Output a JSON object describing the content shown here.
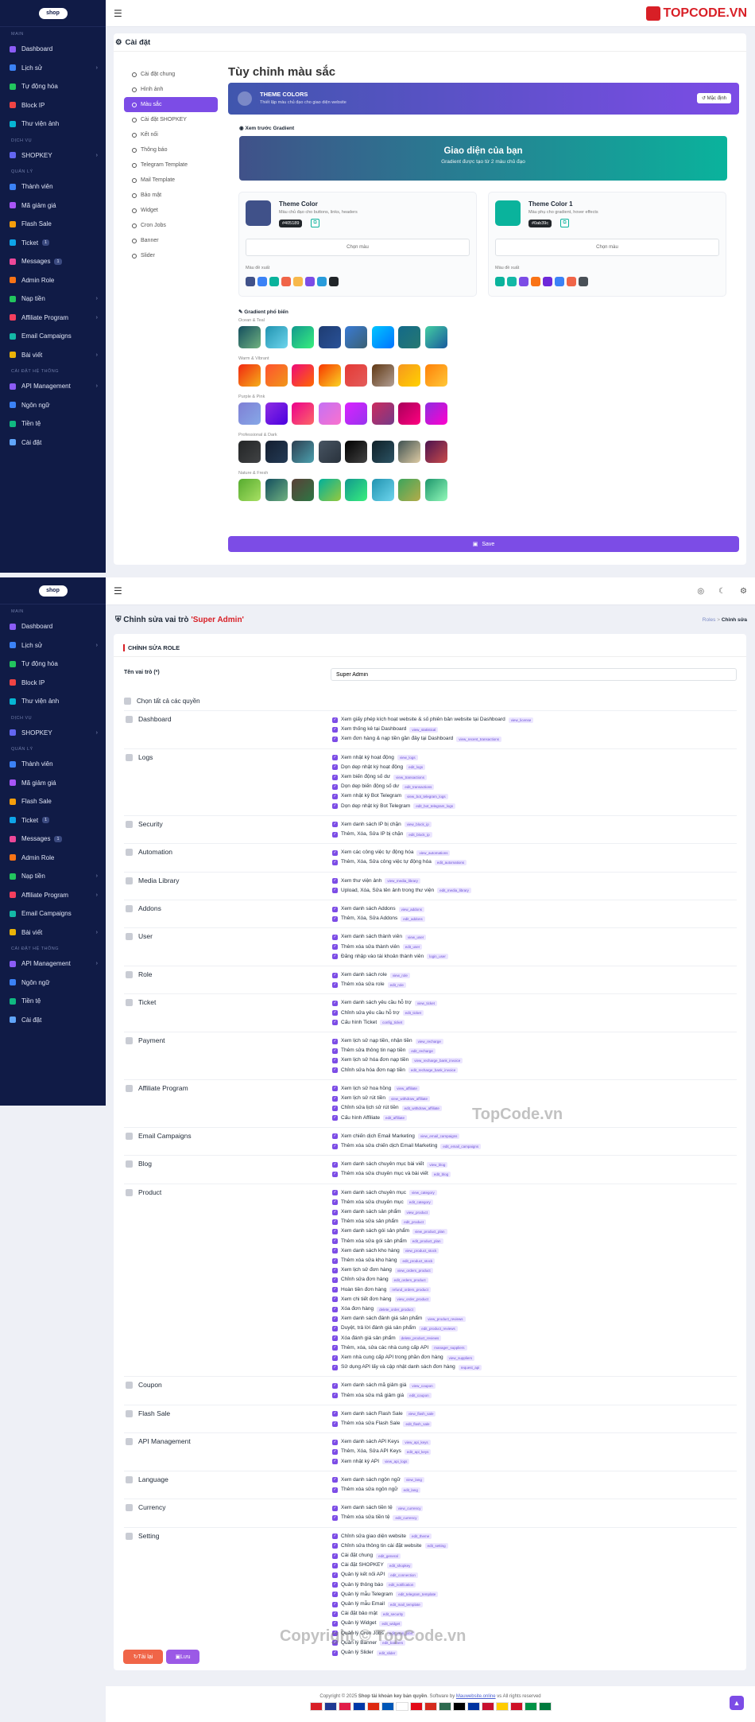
{
  "brand": "TOPCODE.VN",
  "sidebar": {
    "sections": {
      "main": "MAIN",
      "services": "DỊCH VỤ",
      "manage": "QUẢN LÝ",
      "system": "CÀI ĐẶT HỆ THỐNG"
    },
    "main": [
      {
        "label": "Dashboard",
        "color": "#8b5cf6"
      },
      {
        "label": "Lịch sử",
        "color": "#3b82f6",
        "chev": true
      },
      {
        "label": "Tự động hóa",
        "color": "#22c55e"
      },
      {
        "label": "Block IP",
        "color": "#ef4444"
      },
      {
        "label": "Thư viện ảnh",
        "color": "#06b6d4"
      }
    ],
    "services": [
      {
        "label": "SHOPKEY",
        "color": "#6366f1",
        "chev": true
      }
    ],
    "manage": [
      {
        "label": "Thành viên",
        "color": "#3b82f6"
      },
      {
        "label": "Mã giảm giá",
        "color": "#a855f7"
      },
      {
        "label": "Flash Sale",
        "color": "#f59e0b"
      },
      {
        "label": "Ticket",
        "color": "#0ea5e9",
        "badge": "1"
      },
      {
        "label": "Messages",
        "color": "#ec4899",
        "badge": "1"
      },
      {
        "label": "Admin Role",
        "color": "#f97316"
      },
      {
        "label": "Nạp tiền",
        "color": "#22c55e",
        "chev": true
      },
      {
        "label": "Affiliate Program",
        "color": "#f43f5e",
        "chev": true
      },
      {
        "label": "Email Campaigns",
        "color": "#14b8a6"
      },
      {
        "label": "Bài viết",
        "color": "#eab308",
        "chev": true
      }
    ],
    "system": [
      {
        "label": "API Management",
        "color": "#8b5cf6",
        "chev": true
      },
      {
        "label": "Ngôn ngữ",
        "color": "#3b82f6"
      },
      {
        "label": "Tiền tệ",
        "color": "#10b981"
      },
      {
        "label": "Cài đặt",
        "color": "#60a5fa"
      }
    ]
  },
  "settings": {
    "title": "Cài đặt",
    "nav": [
      "Cài đặt chung",
      "Hình ảnh",
      "Màu sắc",
      "Cài đặt SHOPKEY",
      "Kết nối",
      "Thông báo",
      "Telegram Template",
      "Mail Template",
      "Bảo mật",
      "Widget",
      "Cron Jobs",
      "Banner",
      "Slider"
    ],
    "heading": "Tùy chỉnh màu sắc",
    "banner": {
      "title": "THEME COLORS",
      "sub": "Thiết lập màu chủ đạo cho giao diện website",
      "reset": "Mặc định"
    },
    "preview_label": "Xem trước Gradient",
    "preview": {
      "title": "Giao diện của bạn",
      "sub": "Gradient được tạo từ 2 màu chủ đạo"
    },
    "theme1": {
      "title": "Theme Color",
      "desc": "Màu chủ đạo cho buttons, links, headers",
      "hex": "#405189",
      "pick": "Chọn màu",
      "suggest": "Màu đề xuất",
      "swatches": [
        "#405189",
        "#3b82f6",
        "#0ab39c",
        "#f06548",
        "#f7b84b",
        "#7c4ce6",
        "#299cdb",
        "#212529"
      ]
    },
    "theme2": {
      "title": "Theme Color 1",
      "desc": "Màu phụ cho gradient, hover effects",
      "hex": "#0ab39c",
      "pick": "Chọn màu",
      "suggest": "Màu đề xuất",
      "swatches": [
        "#0ab39c",
        "#14b8a6",
        "#7c4ce6",
        "#f97316",
        "#6d28d9",
        "#3b82f6",
        "#f06548",
        "#495057"
      ]
    },
    "gradients_label": "Gradient phổ biến",
    "groups": [
      {
        "name": "Ocean & Teal",
        "items": [
          [
            "#134e5e",
            "#71b280"
          ],
          [
            "#2193b0",
            "#6dd5ed"
          ],
          [
            "#11998e",
            "#38ef7d"
          ],
          [
            "#1e3c72",
            "#2a5298"
          ],
          [
            "#3a7bd5",
            "#3a6073"
          ],
          [
            "#00c6ff",
            "#0072ff"
          ],
          [
            "#136a8a",
            "#267871"
          ],
          [
            "#43cea2",
            "#185a9d"
          ]
        ]
      },
      {
        "name": "Warm & Vibrant",
        "items": [
          [
            "#f12711",
            "#f5af19"
          ],
          [
            "#ff512f",
            "#f09819"
          ],
          [
            "#ee0979",
            "#ff6a00"
          ],
          [
            "#f83600",
            "#f9d423"
          ],
          [
            "#e53935",
            "#e35d5b"
          ],
          [
            "#603813",
            "#b29f94"
          ],
          [
            "#f7971e",
            "#ffd200"
          ],
          [
            "#ff8008",
            "#ffc837"
          ]
        ]
      },
      {
        "name": "Purple & Pink",
        "items": [
          [
            "#7f7fd5",
            "#86a8e7"
          ],
          [
            "#8e2de2",
            "#4a00e0"
          ],
          [
            "#ec008c",
            "#fc6767"
          ],
          [
            "#c471f5",
            "#fa71cd"
          ],
          [
            "#da22ff",
            "#9733ee"
          ],
          [
            "#cc2b5e",
            "#753a88"
          ],
          [
            "#a8005a",
            "#ff0080"
          ],
          [
            "#8e2de2",
            "#ff00cc"
          ]
        ]
      },
      {
        "name": "Professional & Dark",
        "items": [
          [
            "#232526",
            "#414345"
          ],
          [
            "#141e30",
            "#243b55"
          ],
          [
            "#2c3e50",
            "#4ca1af"
          ],
          [
            "#485563",
            "#29323c"
          ],
          [
            "#000000",
            "#434343"
          ],
          [
            "#0f2027",
            "#2c5364"
          ],
          [
            "#3e5151",
            "#decba4"
          ],
          [
            "#4b134f",
            "#c94b4b"
          ]
        ]
      },
      {
        "name": "Nature & Fresh",
        "items": [
          [
            "#56ab2f",
            "#a8e063"
          ],
          [
            "#134e5e",
            "#71b280"
          ],
          [
            "#5a3f37",
            "#2c7744"
          ],
          [
            "#00b09b",
            "#96c93d"
          ],
          [
            "#11998e",
            "#38ef7d"
          ],
          [
            "#2193b0",
            "#6dd5ed"
          ],
          [
            "#3ca55c",
            "#b5ac49"
          ],
          [
            "#1d976c",
            "#93f9b9"
          ]
        ]
      }
    ],
    "save": "Save"
  },
  "role": {
    "title_prefix": "Chỉnh sửa vai trò",
    "title_name": "'Super Admin'",
    "crumb_root": "Roles",
    "crumb_current": "Chỉnh sửa",
    "section": "CHỈNH SỬA ROLE",
    "name_label": "Tên vai trò (*)",
    "name_value": "Super Admin",
    "select_all": "Chọn tất cả các quyền",
    "groups": [
      {
        "name": "Dashboard",
        "perms": [
          [
            "Xem giấy phép kích hoạt website & số phiên bản website tại Dashboard",
            "view_license"
          ],
          [
            "Xem thống kê tại Dashboard",
            "view_statistical"
          ],
          [
            "Xem đơn hàng & nạp tiền gần đây tại Dashboard",
            "view_recent_transactions"
          ]
        ]
      },
      {
        "name": "Logs",
        "perms": [
          [
            "Xem nhật ký hoạt động",
            "view_logs"
          ],
          [
            "Dọn dẹp nhật ký hoạt động",
            "edit_logs"
          ],
          [
            "Xem biến động số dư",
            "view_transactions"
          ],
          [
            "Dọn dẹp biến động số dư",
            "edit_transactions"
          ],
          [
            "Xem nhật ký Bot Telegram",
            "view_bot_telegram_logs"
          ],
          [
            "Dọn dẹp nhật ký Bot Telegram",
            "edit_bot_telegram_logs"
          ]
        ]
      },
      {
        "name": "Security",
        "perms": [
          [
            "Xem danh sách IP bị chặn",
            "view_block_ip"
          ],
          [
            "Thêm, Xóa, Sửa IP bị chặn",
            "edit_block_ip"
          ]
        ]
      },
      {
        "name": "Automation",
        "perms": [
          [
            "Xem các công việc tự động hóa",
            "view_automations"
          ],
          [
            "Thêm, Xóa, Sửa công việc tự động hóa",
            "edit_automations"
          ]
        ]
      },
      {
        "name": "Media Library",
        "perms": [
          [
            "Xem thư viện ảnh",
            "view_media_library"
          ],
          [
            "Upload, Xóa, Sửa tên ảnh trong thư viện",
            "edit_media_library"
          ]
        ]
      },
      {
        "name": "Addons",
        "perms": [
          [
            "Xem danh sách Addons",
            "view_addons"
          ],
          [
            "Thêm, Xóa, Sửa Addons",
            "edit_addons"
          ]
        ]
      },
      {
        "name": "User",
        "perms": [
          [
            "Xem danh sách thành viên",
            "view_user"
          ],
          [
            "Thêm xóa sửa thành viên",
            "edit_user"
          ],
          [
            "Đăng nhập vào tài khoản thành viên",
            "login_user"
          ]
        ]
      },
      {
        "name": "Role",
        "perms": [
          [
            "Xem danh sách role",
            "view_role"
          ],
          [
            "Thêm xóa sửa role",
            "edit_role"
          ]
        ]
      },
      {
        "name": "Ticket",
        "perms": [
          [
            "Xem danh sách yêu cầu hỗ trợ",
            "view_ticket"
          ],
          [
            "Chỉnh sửa yêu cầu hỗ trợ",
            "edit_ticket"
          ],
          [
            "Cấu hình Ticket",
            "config_ticket"
          ]
        ]
      },
      {
        "name": "Payment",
        "perms": [
          [
            "Xem lịch sử nạp tiền, nhận tiền",
            "view_recharge"
          ],
          [
            "Thêm sửa thông tin nạp tiền",
            "edit_recharge"
          ],
          [
            "Xem lịch sử hóa đơn nạp tiền",
            "view_recharge_bank_invoice"
          ],
          [
            "Chỉnh sửa hóa đơn nạp tiền",
            "edit_recharge_bank_invoice"
          ]
        ]
      },
      {
        "name": "Affiliate Program",
        "perms": [
          [
            "Xem lịch sử hoa hồng",
            "view_affiliate"
          ],
          [
            "Xem lịch sử rút tiền",
            "view_withdraw_affiliate"
          ],
          [
            "Chỉnh sửa lịch sử rút tiền",
            "edit_withdraw_affiliate"
          ],
          [
            "Cấu hình Affiliate",
            "edit_affiliate"
          ]
        ]
      },
      {
        "name": "Email Campaigns",
        "perms": [
          [
            "Xem chiến dịch Email Marketing",
            "view_email_campaigns"
          ],
          [
            "Thêm xóa sửa chiến dịch Email Marketing",
            "edit_email_campaigns"
          ]
        ]
      },
      {
        "name": "Blog",
        "perms": [
          [
            "Xem danh sách chuyên mục bài viết",
            "view_blog"
          ],
          [
            "Thêm xóa sửa chuyên mục và bài viết",
            "edit_blog"
          ]
        ]
      },
      {
        "name": "Product",
        "perms": [
          [
            "Xem danh sách chuyên mục",
            "view_category"
          ],
          [
            "Thêm xóa sửa chuyên mục",
            "edit_category"
          ],
          [
            "Xem danh sách sản phẩm",
            "view_product"
          ],
          [
            "Thêm xóa sửa sản phẩm",
            "edit_product"
          ],
          [
            "Xem danh sách gói sản phẩm",
            "view_product_plan"
          ],
          [
            "Thêm xóa sửa gói sản phẩm",
            "edit_product_plan"
          ],
          [
            "Xem danh sách kho hàng",
            "view_product_stock"
          ],
          [
            "Thêm xóa sửa kho hàng",
            "edit_product_stock"
          ],
          [
            "Xem lịch sử đơn hàng",
            "view_orders_product"
          ],
          [
            "Chỉnh sửa đơn hàng",
            "edit_orders_product"
          ],
          [
            "Hoàn tiền đơn hàng",
            "refund_orders_product"
          ],
          [
            "Xem chi tiết đơn hàng",
            "view_order_product"
          ],
          [
            "Xóa đơn hàng",
            "delete_order_product"
          ],
          [
            "Xem danh sách đánh giá sản phẩm",
            "view_product_reviews"
          ],
          [
            "Duyệt, trả lời đánh giá sản phẩm",
            "edit_product_reviews"
          ],
          [
            "Xóa đánh giá sản phẩm",
            "delete_product_reviews"
          ],
          [
            "Thêm, xóa, sửa các nhà cung cấp API",
            "manager_suppliers"
          ],
          [
            "Xem nhà cung cấp API trong phần đơn hàng",
            "view_suppliers"
          ],
          [
            "Sử dụng API lấy và cập nhật danh sách đơn hàng",
            "request_api"
          ]
        ]
      },
      {
        "name": "Coupon",
        "perms": [
          [
            "Xem danh sách mã giảm giá",
            "view_coupon"
          ],
          [
            "Thêm xóa sửa mã giảm giá",
            "edit_coupon"
          ]
        ]
      },
      {
        "name": "Flash Sale",
        "perms": [
          [
            "Xem danh sách Flash Sale",
            "view_flash_sale"
          ],
          [
            "Thêm xóa sửa Flash Sale",
            "edit_flash_sale"
          ]
        ]
      },
      {
        "name": "API Management",
        "perms": [
          [
            "Xem danh sách API Keys",
            "view_api_keys"
          ],
          [
            "Thêm, Xóa, Sửa API Keys",
            "edit_api_keys"
          ],
          [
            "Xem nhật ký API",
            "view_api_logs"
          ]
        ]
      },
      {
        "name": "Language",
        "perms": [
          [
            "Xem danh sách ngôn ngữ",
            "view_lang"
          ],
          [
            "Thêm xóa sửa ngôn ngữ",
            "edit_lang"
          ]
        ]
      },
      {
        "name": "Currency",
        "perms": [
          [
            "Xem danh sách tiền tệ",
            "view_currency"
          ],
          [
            "Thêm xóa sửa tiền tệ",
            "edit_currency"
          ]
        ]
      },
      {
        "name": "Setting",
        "perms": [
          [
            "Chỉnh sửa giao diện website",
            "edit_theme"
          ],
          [
            "Chỉnh sửa thông tin cài đặt website",
            "edit_setting"
          ],
          [
            "Cài đặt chung",
            "edit_general"
          ],
          [
            "Cài đặt SHOPKEY",
            "edit_shopkey"
          ],
          [
            "Quản lý kết nối API",
            "edit_connection"
          ],
          [
            "Quản lý thông báo",
            "edit_notification"
          ],
          [
            "Quản lý mẫu Telegram",
            "edit_telegram_template"
          ],
          [
            "Quản lý mẫu Email",
            "edit_mail_template"
          ],
          [
            "Cài đặt bảo mật",
            "edit_security"
          ],
          [
            "Quản lý Widget",
            "edit_widget"
          ],
          [
            "Quản lý Cron Jobs",
            "edit_cron_jobs"
          ],
          [
            "Quản lý Banner",
            "edit_banners"
          ],
          [
            "Quản lý Slider",
            "edit_slider"
          ]
        ]
      }
    ],
    "reset": "Tải lại",
    "save": "Lưu"
  },
  "footer": {
    "pre": "Copyright © 2025",
    "site": "Shop tài khoản key bản quyền",
    "mid": "Software by",
    "by": "Mauwebsite.online",
    "post": "vs All rights reserved"
  },
  "watermarks": {
    "mid": "TopCode.vn",
    "bottom": "Copyright © TopCode.vn"
  }
}
